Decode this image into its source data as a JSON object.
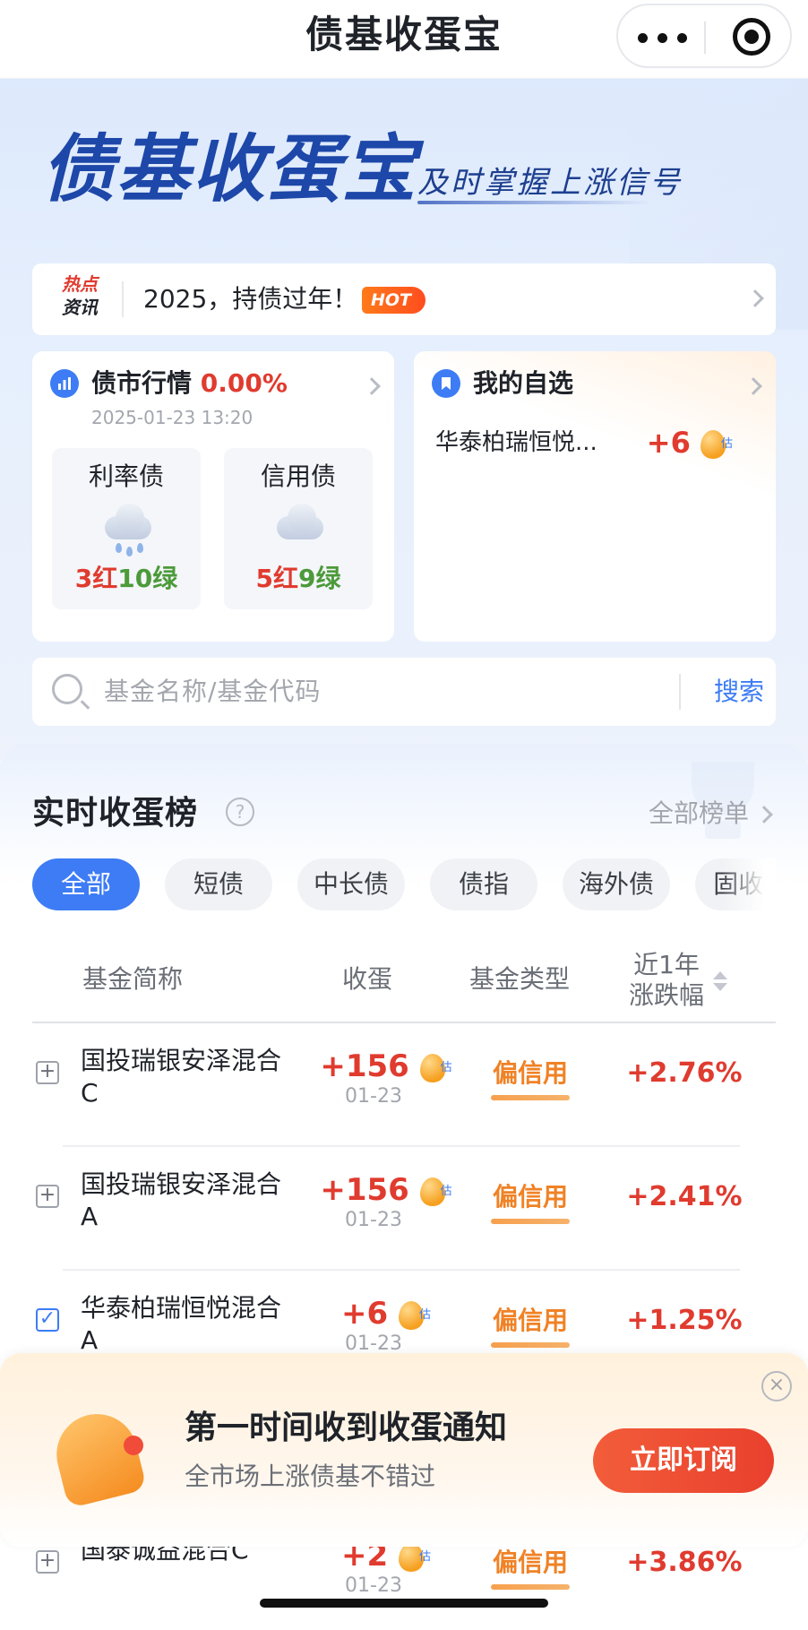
{
  "nav": {
    "title": "债基收蛋宝"
  },
  "hero": {
    "logo": "债基收蛋宝",
    "slogan": "及时掌握上涨信号"
  },
  "news": {
    "tag_line1": "热点",
    "tag_line2": "资讯",
    "text": "2025，持债过年！",
    "badge": "HOT"
  },
  "market": {
    "title": "债市行情",
    "pct": "0.00%",
    "time": "2025-01-23 13:20",
    "rate_bond": {
      "name": "利率债",
      "red": "3红",
      "green": "10绿"
    },
    "credit_bond": {
      "name": "信用债",
      "red": "5红",
      "green": "9绿"
    }
  },
  "favorites": {
    "title": "我的自选",
    "item_name": "华泰柏瑞恒悦...",
    "item_value": "+6",
    "est": "估"
  },
  "search": {
    "placeholder": "基金名称/基金代码",
    "button": "搜索"
  },
  "ranking": {
    "title": "实时收蛋榜",
    "help": "?",
    "all_label": "全部榜单",
    "tabs": [
      "全部",
      "短债",
      "中长债",
      "债指",
      "海外债",
      "固收+"
    ],
    "headers": {
      "name": "基金简称",
      "eggs": "收蛋",
      "type": "基金类型",
      "change_l1": "近1年",
      "change_l2": "涨跌幅"
    },
    "rows": [
      {
        "name": "国投瑞银安泽混合C",
        "eggs": "+156",
        "date": "01-23",
        "type": "偏信用",
        "change": "+2.76%",
        "checked": "+"
      },
      {
        "name": "国投瑞银安泽混合A",
        "eggs": "+156",
        "date": "01-23",
        "type": "偏信用",
        "change": "+2.41%",
        "checked": "+"
      },
      {
        "name": "华泰柏瑞恒悦混合A",
        "eggs": "+6",
        "date": "01-23",
        "type": "偏信用",
        "change": "+1.25%",
        "checked": "✓"
      },
      {
        "name": "国泰诚益混合C",
        "eggs": "+2",
        "date": "01-23",
        "type": "偏信用",
        "change": "+3.86%",
        "checked": "+"
      }
    ]
  },
  "popup": {
    "title": "第一时间收到收蛋通知",
    "subtitle": "全市场上涨债基不错过",
    "button": "立即订阅",
    "close": "×"
  },
  "colors": {
    "accent": "#3d7cf5",
    "up_red": "#e03b2f",
    "down_green": "#4c9a3a",
    "type_orange": "#f08226"
  }
}
